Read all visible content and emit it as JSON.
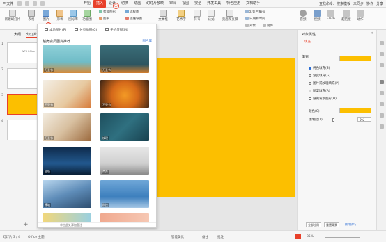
{
  "titlebar": {
    "file_menu": "文件",
    "tabs": [
      "开始",
      "插入",
      "设计",
      "切换",
      "动画",
      "幻灯片放映",
      "审阅",
      "视图",
      "安全",
      "开发工具",
      "特色应用",
      "文档助手"
    ],
    "active_tab": "插入",
    "search": "查找命令、搜索模板",
    "right_items": [
      "未同步",
      "协作",
      "分享"
    ]
  },
  "ribbon": {
    "new_slide": "新建幻灯片",
    "table": "表格",
    "picture": "图片",
    "shape": "形状",
    "icon_lib": "图标库",
    "function_chart": "功能图",
    "smart_art": "智能图形",
    "chart": "图表",
    "online_chart": "在线图表",
    "flowchart": "流程图",
    "mind_map": "思维导图",
    "relation_map": "关系图",
    "textbox": "文本框",
    "art_text": "艺术字",
    "symbol": "符号",
    "formula": "公式",
    "header_footer": "页眉和页脚",
    "slide_number": "幻灯片编号",
    "datetime": "日期和时间",
    "object": "对象",
    "attachment": "附件",
    "audio": "音频",
    "video": "视频",
    "flash": "Flash",
    "hyperlink": "超链接",
    "action": "动作"
  },
  "callouts": {
    "one": "①",
    "two": "②"
  },
  "left_panel": {
    "tabs": [
      "大纲",
      "幻灯片"
    ],
    "active_tab": "幻灯片",
    "slides": [
      {
        "num": "1",
        "text": "WPS Office"
      },
      {
        "num": "2",
        "text": ""
      },
      {
        "num": "3",
        "text": ""
      },
      {
        "num": "4",
        "text": ""
      }
    ],
    "selected": "3",
    "add_slide": "+"
  },
  "picture_menu": {
    "options": [
      "本地图片(P)",
      "分页插图(G)",
      "手机传图(M)"
    ],
    "heading": "稻壳会员图片推荐",
    "more": "图片库",
    "tiles": [
      {
        "label": "万圣节"
      },
      {
        "label": "万圣节"
      },
      {
        "label": "万圣节"
      },
      {
        "label": "万圣节"
      },
      {
        "label": "万圣节"
      },
      {
        "label": "纹理"
      },
      {
        "label": "蓝色"
      },
      {
        "label": "商务"
      },
      {
        "label": "建筑"
      },
      {
        "label": "科技"
      },
      {
        "label": ""
      },
      {
        "label": ""
      }
    ],
    "footer": "单击此处添加备注"
  },
  "right_panel": {
    "title": "对象属性",
    "tab": "填充",
    "section": "填充",
    "fill_options": [
      "纯色填充(S)",
      "渐变填充(G)",
      "图片或纹理填充(P)",
      "图案填充(A)"
    ],
    "selected_fill": "纯色填充(S)",
    "hide_bg": "隐藏背景图形(H)",
    "color_label": "颜色(C)",
    "transparency_label": "透明度(T)",
    "transparency_value": "0%",
    "transparency": 0,
    "buttons": [
      "全部应用",
      "重置背景",
      "操作技巧"
    ],
    "fill_color": "#fcbf00"
  },
  "status_bar": {
    "slide_count": "幻灯片 3 / 4",
    "theme": "Office 主题",
    "smart_beautify": "智能美化",
    "notes": "备注",
    "comments": "批注",
    "zoom": "85%"
  },
  "colors": {
    "accent": "#e8402a",
    "slide": "#fcbf00"
  }
}
